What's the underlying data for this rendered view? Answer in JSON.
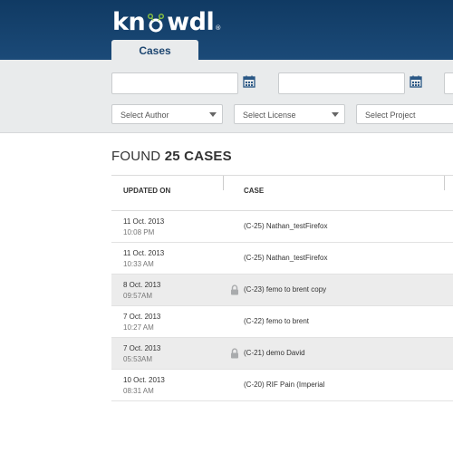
{
  "brand": {
    "logo_left": "kn",
    "logo_right": "wdl",
    "reg": "®"
  },
  "tabs": [
    {
      "label": "Cases"
    }
  ],
  "filters": {
    "author_placeholder": "Select Author",
    "license_placeholder": "Select License",
    "project_placeholder": "Select Project"
  },
  "results": {
    "found_prefix": "FOUND",
    "found_count": "25 CASES"
  },
  "table": {
    "headers": {
      "updated_on": "UPDATED ON",
      "case": "CASE"
    },
    "rows": [
      {
        "date": "11 Oct. 2013",
        "time": "10:08 PM",
        "case": "(C-25) Nathan_testFirefox",
        "locked": false
      },
      {
        "date": "11 Oct. 2013",
        "time": "10:33 AM",
        "case": "(C-25) Nathan_testFirefox",
        "locked": false
      },
      {
        "date": "8 Oct. 2013",
        "time": "09:57AM",
        "case": "(C-23) femo to brent copy",
        "locked": true
      },
      {
        "date": "7 Oct. 2013",
        "time": "10:27 AM",
        "case": "(C-22) femo to brent",
        "locked": false
      },
      {
        "date": "7 Oct. 2013",
        "time": "05:53AM",
        "case": "(C-21) demo David",
        "locked": true
      },
      {
        "date": "10 Oct. 2013",
        "time": "08:31 AM",
        "case": "(C-20) RIF Pain (Imperial",
        "locked": false
      }
    ]
  },
  "colors": {
    "header": "#133f6b",
    "accent": "#8dc63f",
    "tab_text": "#1e4670",
    "alt_row": "#ececec"
  }
}
